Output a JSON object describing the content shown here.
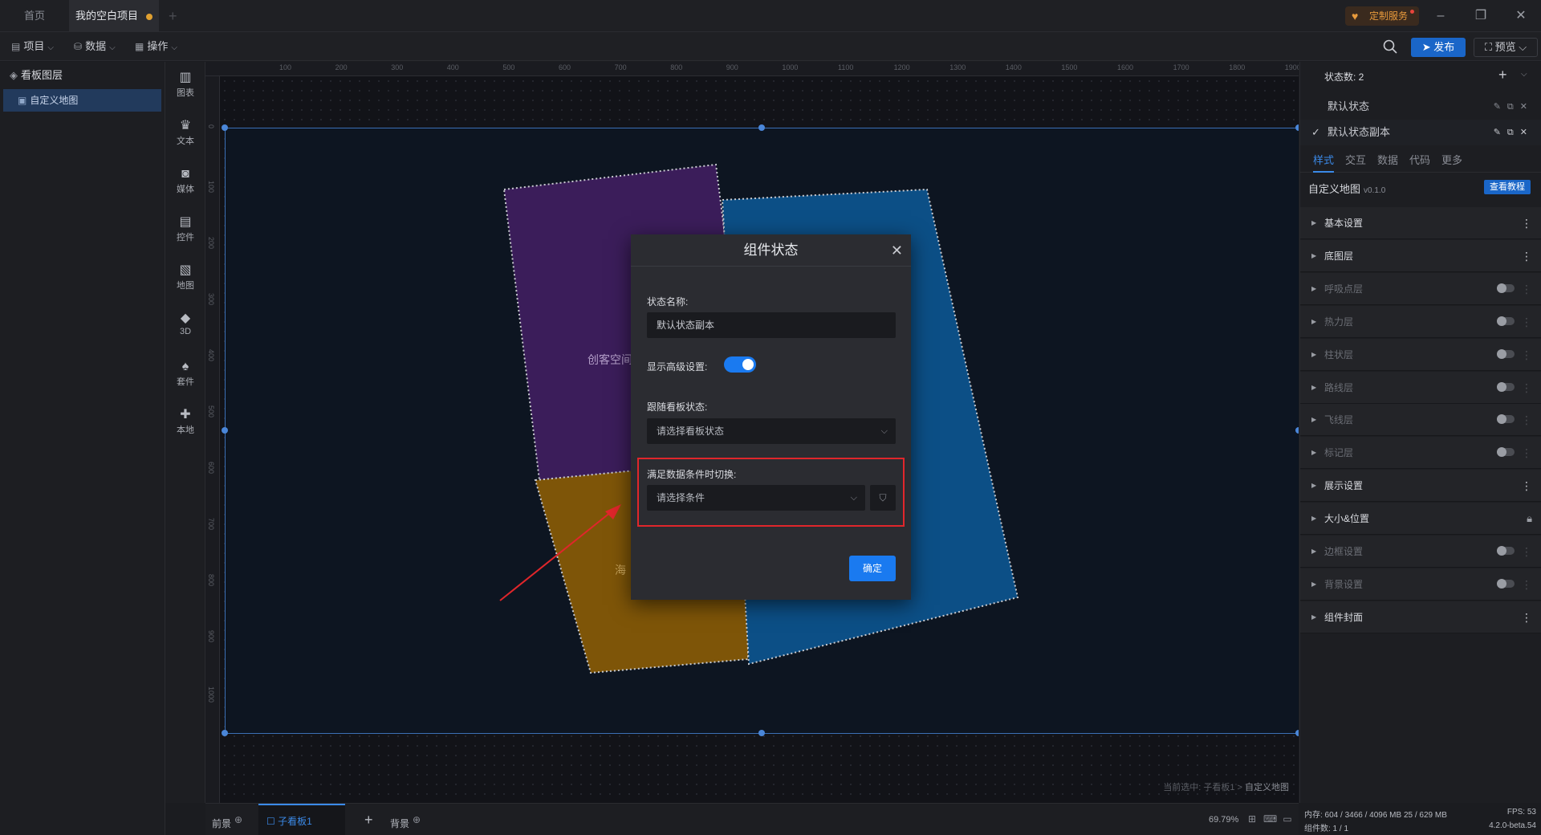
{
  "titlebar": {
    "tabs": [
      {
        "label": "首页"
      },
      {
        "label": "我的空白项目"
      }
    ],
    "custom_service": "定制服务",
    "colors": {
      "accent": "#1a7af0",
      "alert": "#e0262b"
    }
  },
  "toolbar": {
    "menus": [
      {
        "label": "项目",
        "icon": "file-icon"
      },
      {
        "label": "数据",
        "icon": "database-icon"
      },
      {
        "label": "操作",
        "icon": "grid-icon"
      }
    ],
    "publish": "发布",
    "preview": "预览"
  },
  "layers": {
    "title": "看板图层",
    "items": [
      {
        "label": "自定义地图"
      }
    ]
  },
  "components": [
    {
      "label": "图表",
      "icon": "chart-icon"
    },
    {
      "label": "文本",
      "icon": "text-icon"
    },
    {
      "label": "媒体",
      "icon": "media-icon"
    },
    {
      "label": "控件",
      "icon": "control-icon"
    },
    {
      "label": "地图",
      "icon": "map-icon"
    },
    {
      "label": "3D",
      "icon": "cube-icon"
    },
    {
      "label": "套件",
      "icon": "shirt-icon"
    },
    {
      "label": "本地",
      "icon": "puzzle-icon"
    }
  ],
  "ruler": {
    "h": [
      "100",
      "200",
      "300",
      "400",
      "500",
      "600",
      "700",
      "800",
      "900",
      "1000",
      "1100",
      "1200",
      "1300",
      "1400",
      "1500",
      "1600",
      "1700",
      "1800",
      "1900"
    ],
    "v": [
      "0",
      "100",
      "200",
      "300",
      "400",
      "500",
      "600",
      "700",
      "800",
      "900",
      "1000"
    ]
  },
  "canvas": {
    "map_label_1": "创客空间",
    "map_label_2": "海",
    "selection_prefix": "当前选中: 子看板1 >",
    "selection_target": "自定义地图"
  },
  "modal": {
    "title": "组件状态",
    "name_label": "状态名称:",
    "name_value": "默认状态副本",
    "advanced_label": "显示高级设置:",
    "advanced_on": true,
    "follow_label": "跟随看板状态:",
    "follow_placeholder": "请选择看板状态",
    "condition_label": "满足数据条件时切换:",
    "condition_placeholder": "请选择条件",
    "confirm": "确定"
  },
  "bottombar": {
    "tabs": [
      {
        "label": "前景"
      },
      {
        "label": "子看板1"
      },
      {
        "label": "背景"
      }
    ],
    "zoom": "69.79%"
  },
  "right": {
    "state_count": "状态数: 2",
    "states": [
      {
        "label": "默认状态",
        "active": false
      },
      {
        "label": "默认状态副本",
        "active": true
      }
    ],
    "tabs": [
      {
        "label": "样式"
      },
      {
        "label": "交互"
      },
      {
        "label": "数据"
      },
      {
        "label": "代码"
      },
      {
        "label": "更多"
      }
    ],
    "component_name": "自定义地图",
    "version": "v0.1.0",
    "tutorial": "查看教程",
    "sections": [
      {
        "label": "基本设置",
        "type": "more",
        "dim": false
      },
      {
        "label": "底图层",
        "type": "more",
        "dim": false
      },
      {
        "label": "呼吸点层",
        "type": "switch",
        "dim": true
      },
      {
        "label": "热力层",
        "type": "switch",
        "dim": true
      },
      {
        "label": "柱状层",
        "type": "switch",
        "dim": true
      },
      {
        "label": "路线层",
        "type": "switch",
        "dim": true
      },
      {
        "label": "飞线层",
        "type": "switch",
        "dim": true
      },
      {
        "label": "标记层",
        "type": "switch",
        "dim": true
      },
      {
        "label": "展示设置",
        "type": "more",
        "dim": false
      },
      {
        "label": "大小&位置",
        "type": "lock",
        "dim": false
      },
      {
        "label": "边框设置",
        "type": "switch",
        "dim": true
      },
      {
        "label": "背景设置",
        "type": "switch",
        "dim": true
      },
      {
        "label": "组件封面",
        "type": "more",
        "dim": false
      }
    ]
  },
  "stats": {
    "memory": "内存: 604 / 3466 / 4096 MB 25 / 629 MB",
    "fps": "FPS: 53",
    "count": "组件数: 1 / 1",
    "version": "4.2.0-beta.54"
  }
}
